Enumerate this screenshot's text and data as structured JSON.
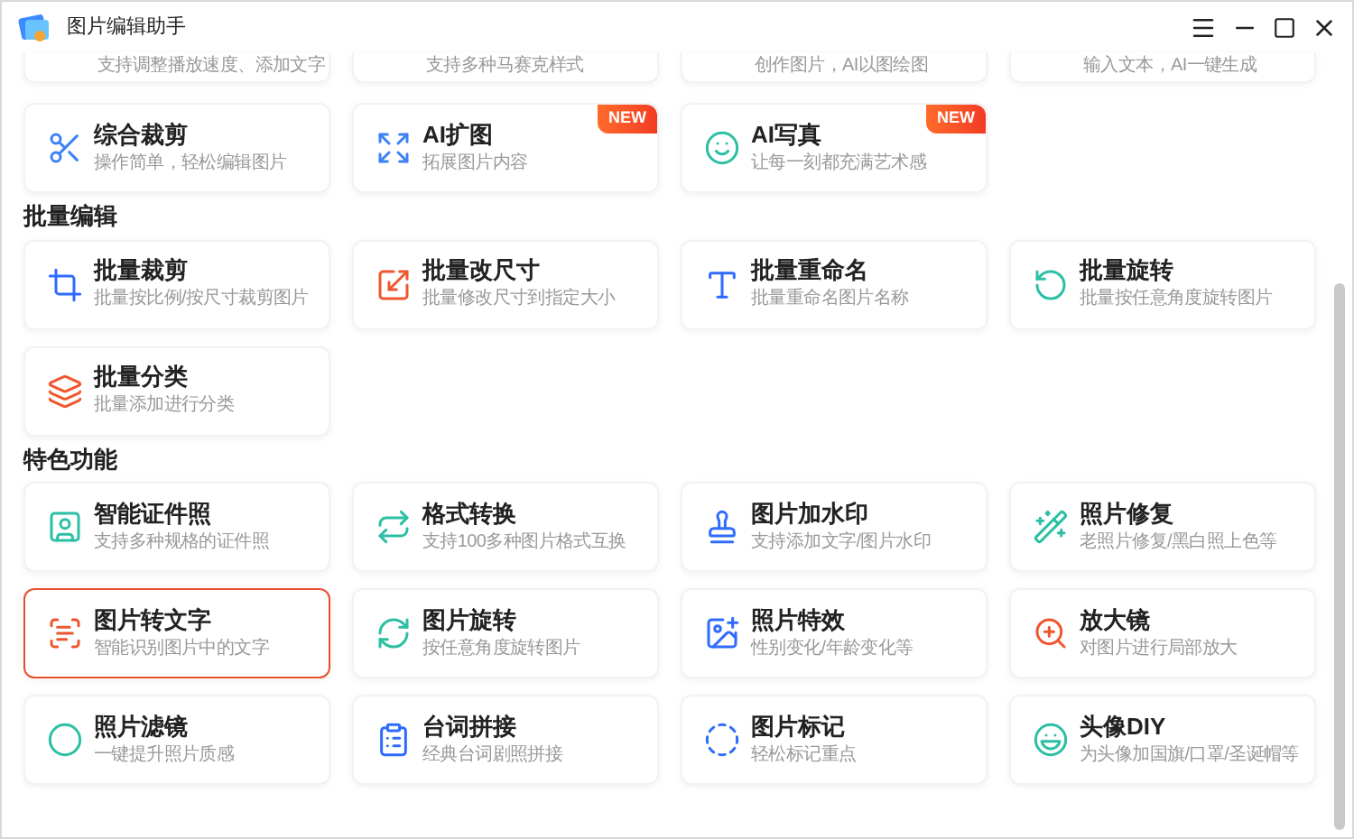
{
  "window": {
    "title": "图片编辑助手"
  },
  "top_row": [
    {
      "desc": "支持调整播放速度、添加文字"
    },
    {
      "desc": "支持多种马赛克样式"
    },
    {
      "desc": "创作图片，AI以图绘图"
    },
    {
      "desc": "输入文本，AI一键生成"
    }
  ],
  "sections": [
    {
      "cards": [
        {
          "title": "综合裁剪",
          "desc": "操作简单，轻松编辑图片",
          "selected": false
        },
        {
          "title": "AI扩图",
          "desc": "拓展图片内容",
          "badge": "NEW",
          "selected": false
        },
        {
          "title": "AI写真",
          "desc": "让每一刻都充满艺术感",
          "badge": "NEW",
          "selected": false
        }
      ]
    },
    {
      "heading": "批量编辑",
      "cards": [
        {
          "title": "批量裁剪",
          "desc": "批量按比例/按尺寸裁剪图片",
          "selected": false
        },
        {
          "title": "批量改尺寸",
          "desc": "批量修改尺寸到指定大小",
          "selected": false
        },
        {
          "title": "批量重命名",
          "desc": "批量重命名图片名称",
          "selected": false
        },
        {
          "title": "批量旋转",
          "desc": "批量按任意角度旋转图片",
          "selected": false
        },
        {
          "title": "批量分类",
          "desc": "批量添加进行分类",
          "selected": false
        }
      ]
    },
    {
      "heading": "特色功能",
      "cards": [
        {
          "title": "智能证件照",
          "desc": "支持多种规格的证件照",
          "selected": false
        },
        {
          "title": "格式转换",
          "desc": "支持100多种图片格式互换",
          "selected": false
        },
        {
          "title": "图片加水印",
          "desc": "支持添加文字/图片水印",
          "selected": false
        },
        {
          "title": "照片修复",
          "desc": "老照片修复/黑白照上色等",
          "selected": false
        },
        {
          "title": "图片转文字",
          "desc": "智能识别图片中的文字",
          "selected": true
        },
        {
          "title": "图片旋转",
          "desc": "按任意角度旋转图片",
          "selected": false
        },
        {
          "title": "照片特效",
          "desc": "性别变化/年龄变化等",
          "selected": false
        },
        {
          "title": "放大镜",
          "desc": "对图片进行局部放大",
          "selected": false
        },
        {
          "title": "照片滤镜",
          "desc": "一键提升照片质感",
          "selected": false
        },
        {
          "title": "台词拼接",
          "desc": "经典台词剧照拼接",
          "selected": false
        },
        {
          "title": "图片标记",
          "desc": "轻松标记重点",
          "selected": false
        },
        {
          "title": "头像DIY",
          "desc": "为头像加国旗/口罩/圣诞帽等",
          "selected": false
        }
      ]
    }
  ]
}
